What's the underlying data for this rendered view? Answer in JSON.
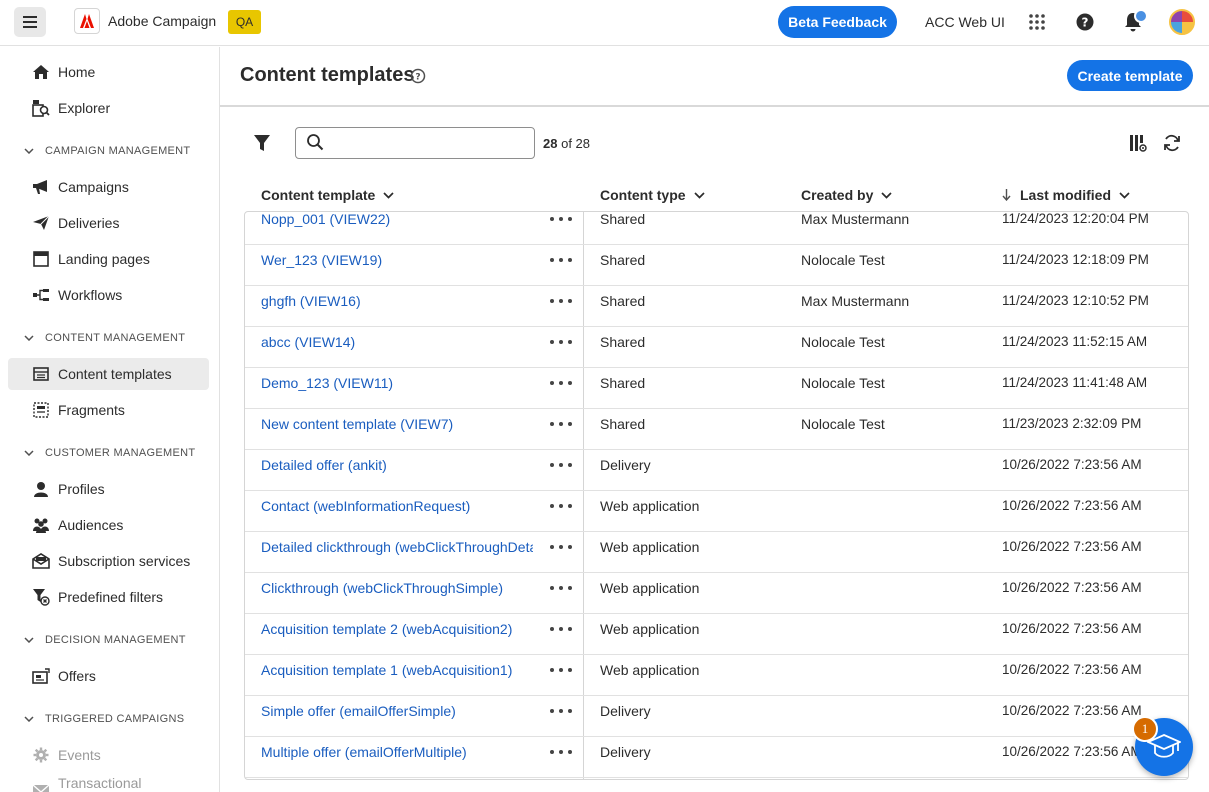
{
  "topbar": {
    "app_name": "Adobe Campaign",
    "env_badge": "QA",
    "beta_feedback": "Beta Feedback",
    "org_name": "ACC Web UI"
  },
  "sidebar": {
    "items_top": [
      {
        "label": "Home",
        "icon": "home-icon"
      },
      {
        "label": "Explorer",
        "icon": "explorer-icon"
      }
    ],
    "sections": [
      {
        "title": "CAMPAIGN MANAGEMENT",
        "items": [
          {
            "label": "Campaigns",
            "icon": "megaphone-icon"
          },
          {
            "label": "Deliveries",
            "icon": "send-icon"
          },
          {
            "label": "Landing pages",
            "icon": "browser-icon"
          },
          {
            "label": "Workflows",
            "icon": "workflow-icon"
          }
        ]
      },
      {
        "title": "CONTENT MANAGEMENT",
        "items": [
          {
            "label": "Content templates",
            "icon": "template-icon"
          },
          {
            "label": "Fragments",
            "icon": "fragment-icon"
          }
        ]
      },
      {
        "title": "CUSTOMER MANAGEMENT",
        "items": [
          {
            "label": "Profiles",
            "icon": "user-icon"
          },
          {
            "label": "Audiences",
            "icon": "users-icon"
          },
          {
            "label": "Subscription services",
            "icon": "envelope-icon"
          },
          {
            "label": "Predefined filters",
            "icon": "filter-icon"
          }
        ]
      },
      {
        "title": "DECISION MANAGEMENT",
        "items": [
          {
            "label": "Offers",
            "icon": "offer-icon"
          }
        ]
      },
      {
        "title": "TRIGGERED CAMPAIGNS",
        "items": [
          {
            "label": "Events",
            "icon": "gear-icon"
          },
          {
            "label": "Transactional messages",
            "icon": "mail-icon"
          }
        ]
      }
    ]
  },
  "main": {
    "title": "Content templates",
    "create_button": "Create template",
    "search_placeholder": "",
    "count_shown": "28",
    "count_total": "of 28",
    "columns": {
      "name": "Content template",
      "type": "Content type",
      "created_by": "Created by",
      "last_modified": "Last modified"
    },
    "rows": [
      {
        "name": "Nopp_001 (VIEW22)",
        "type": "Shared",
        "created_by": "Max Mustermann",
        "modified": "11/24/2023 12:20:04 PM"
      },
      {
        "name": "Wer_123 (VIEW19)",
        "type": "Shared",
        "created_by": "Nolocale Test",
        "modified": "11/24/2023 12:18:09 PM"
      },
      {
        "name": "ghgfh (VIEW16)",
        "type": "Shared",
        "created_by": "Max Mustermann",
        "modified": "11/24/2023 12:10:52 PM"
      },
      {
        "name": "abcc (VIEW14)",
        "type": "Shared",
        "created_by": "Nolocale Test",
        "modified": "11/24/2023 11:52:15 AM"
      },
      {
        "name": "Demo_123 (VIEW11)",
        "type": "Shared",
        "created_by": "Nolocale Test",
        "modified": "11/24/2023 11:41:48 AM"
      },
      {
        "name": "New content template (VIEW7)",
        "type": "Shared",
        "created_by": "Nolocale Test",
        "modified": "11/23/2023 2:32:09 PM"
      },
      {
        "name": "Detailed offer (ankit)",
        "type": "Delivery",
        "created_by": "",
        "modified": "10/26/2022 7:23:56 AM"
      },
      {
        "name": "Contact (webInformationRequest)",
        "type": "Web application",
        "created_by": "",
        "modified": "10/26/2022 7:23:56 AM"
      },
      {
        "name": "Detailed clickthrough (webClickThroughDeta...",
        "type": "Web application",
        "created_by": "",
        "modified": "10/26/2022 7:23:56 AM"
      },
      {
        "name": "Clickthrough (webClickThroughSimple)",
        "type": "Web application",
        "created_by": "",
        "modified": "10/26/2022 7:23:56 AM"
      },
      {
        "name": "Acquisition template 2 (webAcquisition2)",
        "type": "Web application",
        "created_by": "",
        "modified": "10/26/2022 7:23:56 AM"
      },
      {
        "name": "Acquisition template 1 (webAcquisition1)",
        "type": "Web application",
        "created_by": "",
        "modified": "10/26/2022 7:23:56 AM"
      },
      {
        "name": "Simple offer (emailOfferSimple)",
        "type": "Delivery",
        "created_by": "",
        "modified": "10/26/2022 7:23:56 AM"
      },
      {
        "name": "Multiple offer (emailOfferMultiple)",
        "type": "Delivery",
        "created_by": "",
        "modified": "10/26/2022 7:23:56 AM"
      }
    ]
  },
  "learn": {
    "badge_count": "1"
  },
  "colors": {
    "accent": "#1473e6",
    "link": "#1a5dbf",
    "badge": "#d66b00",
    "qa": "#e8c600"
  }
}
